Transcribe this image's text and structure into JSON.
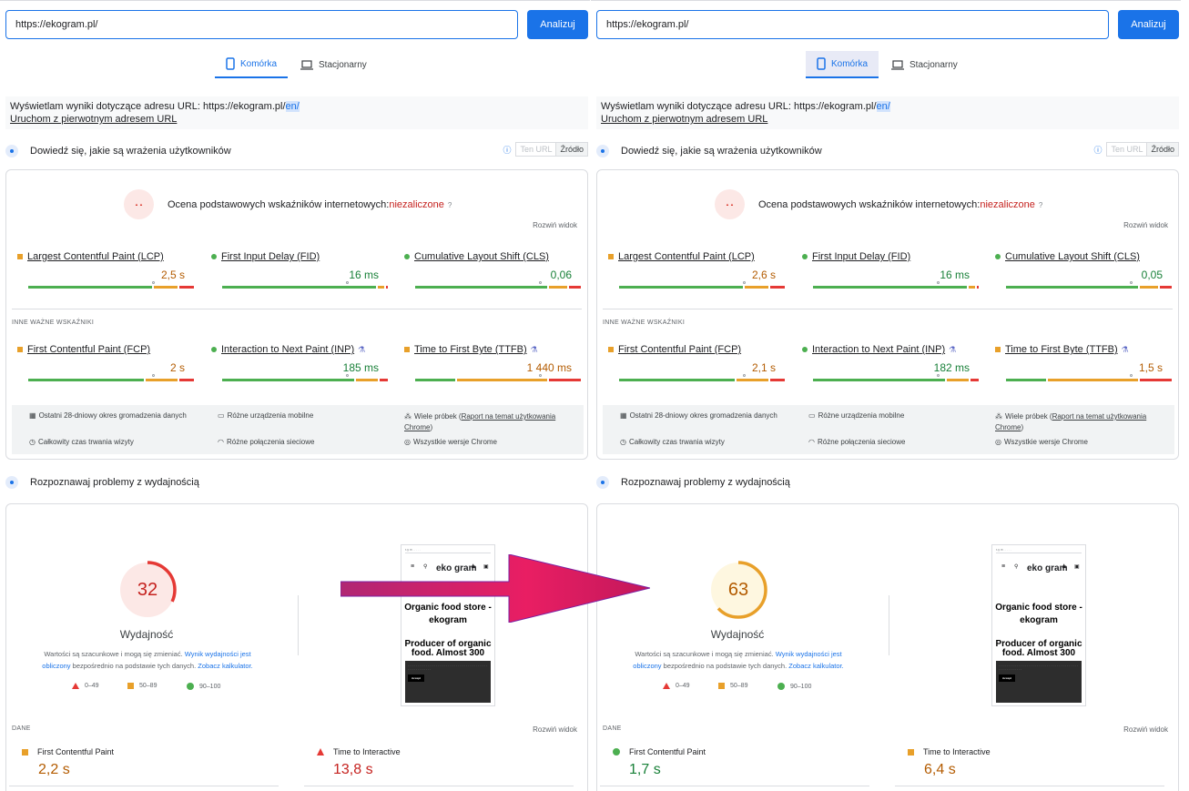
{
  "left": {
    "url": "https://ekogram.pl/",
    "analyze": "Analizuj",
    "tab_mobile": "Komórka",
    "tab_desktop": "Stacjonarny",
    "notice_prefix": "Wyświetlam wyniki dotyczące adresu URL: https://ekogram.pl/",
    "notice_hl": "en/",
    "notice_link": "Uruchom z pierwotnym adresem URL",
    "ux_title": "Dowiedź się, jakie są wrażenia użytkowników",
    "this_url": "Ten URL",
    "source": "Źródło",
    "cwv_label": "Ocena podstawowych wskaźników internetowych:",
    "cwv_status": "niezaliczone",
    "expand": "Rozwiń widok",
    "other_header": "INNE WAŻNE WSKAŹNIKI",
    "metrics": [
      {
        "name": "Largest Contentful Paint (LCP)",
        "value": "2,5 s",
        "status": "orange"
      },
      {
        "name": "First Input Delay (FID)",
        "value": "16 ms",
        "status": "green"
      },
      {
        "name": "Cumulative Layout Shift (CLS)",
        "value": "0,06",
        "status": "green"
      },
      {
        "name": "First Contentful Paint (FCP)",
        "value": "2 s",
        "status": "orange"
      },
      {
        "name": "Interaction to Next Paint (INP)",
        "value": "185 ms",
        "status": "green"
      },
      {
        "name": "Time to First Byte (TTFB)",
        "value": "1 440 ms",
        "status": "orange"
      }
    ],
    "meta": [
      "Ostatni 28-dniowy okres gromadzenia danych",
      "Różne urządzenia mobilne",
      "Wiele próbek (",
      "Raport na temat użytkowania Chrome",
      ")",
      "Całkowity czas trwania wizyty",
      "Różne połączenia sieciowe",
      "Wszystkie wersje Chrome"
    ],
    "perf_title": "Rozpoznawaj problemy z wydajnością",
    "score": "32",
    "score_fraction": 0.32,
    "score_color": "#e53935",
    "score_bg": "#fce8e6",
    "perf_label": "Wydajność",
    "perf_desc1": "Wartości są szacunkowe i mogą się zmieniać.",
    "perf_link1": "Wynik wydajności jest obliczony",
    "perf_desc2": "bezpośrednio na podstawie tych danych.",
    "perf_link2": "Zobacz kalkulator.",
    "legend": [
      "0–49",
      "50–89",
      "90–100"
    ],
    "thumb": {
      "logo": "eko gram",
      "h1": "Organic food store - ekogram",
      "h2": "Producer of organic food. Almost 300",
      "btn": "Accept"
    },
    "dane": "DANE",
    "lab1": {
      "name": "First Contentful Paint",
      "value": "2,2 s",
      "status": "orange"
    },
    "lab2": {
      "name": "Time to Interactive",
      "value": "13,8 s",
      "status": "red"
    }
  },
  "right": {
    "url": "https://ekogram.pl/",
    "analyze": "Analizuj",
    "tab_mobile": "Komórka",
    "tab_desktop": "Stacjonarny",
    "notice_prefix": "Wyświetlam wyniki dotyczące adresu URL: https://ekogram.pl/",
    "notice_hl": "en/",
    "notice_link": "Uruchom z pierwotnym adresem URL",
    "ux_title": "Dowiedź się, jakie są wrażenia użytkowników",
    "this_url": "Ten URL",
    "source": "Źródło",
    "cwv_label": "Ocena podstawowych wskaźników internetowych:",
    "cwv_status": "niezaliczone",
    "expand": "Rozwiń widok",
    "other_header": "INNE WAŻNE WSKAŹNIKI",
    "metrics": [
      {
        "name": "Largest Contentful Paint (LCP)",
        "value": "2,6 s",
        "status": "orange"
      },
      {
        "name": "First Input Delay (FID)",
        "value": "16 ms",
        "status": "green"
      },
      {
        "name": "Cumulative Layout Shift (CLS)",
        "value": "0,05",
        "status": "green"
      },
      {
        "name": "First Contentful Paint (FCP)",
        "value": "2,1 s",
        "status": "orange"
      },
      {
        "name": "Interaction to Next Paint (INP)",
        "value": "182 ms",
        "status": "green"
      },
      {
        "name": "Time to First Byte (TTFB)",
        "value": "1,5 s",
        "status": "orange"
      }
    ],
    "meta": [
      "Ostatni 28-dniowy okres gromadzenia danych",
      "Różne urządzenia mobilne",
      "Wiele próbek (",
      "Raport na temat użytkowania Chrome",
      ")",
      "Całkowity czas trwania wizyty",
      "Różne połączenia sieciowe",
      "Wszystkie wersje Chrome"
    ],
    "perf_title": "Rozpoznawaj problemy z wydajnością",
    "score": "63",
    "score_fraction": 0.63,
    "score_color": "#e8a02a",
    "score_bg": "#fef7e0",
    "perf_label": "Wydajność",
    "perf_desc1": "Wartości są szacunkowe i mogą się zmieniać.",
    "perf_link1": "Wynik wydajności jest obliczony",
    "perf_desc2": "bezpośrednio na podstawie tych danych.",
    "perf_link2": "Zobacz kalkulator.",
    "legend": [
      "0–49",
      "50–89",
      "90–100"
    ],
    "thumb": {
      "logo": "eko gram",
      "h1": "Organic food store - ekogram",
      "h2": "Producer of organic food. Almost 300",
      "btn": "Accept"
    },
    "dane": "DANE",
    "lab1": {
      "name": "First Contentful Paint",
      "value": "1,7 s",
      "status": "green"
    },
    "lab2": {
      "name": "Time to Interactive",
      "value": "6,4 s",
      "status": "orange"
    }
  },
  "arrow_colors": [
    "#c2185b",
    "#e91e63",
    "#7b1fa2"
  ]
}
